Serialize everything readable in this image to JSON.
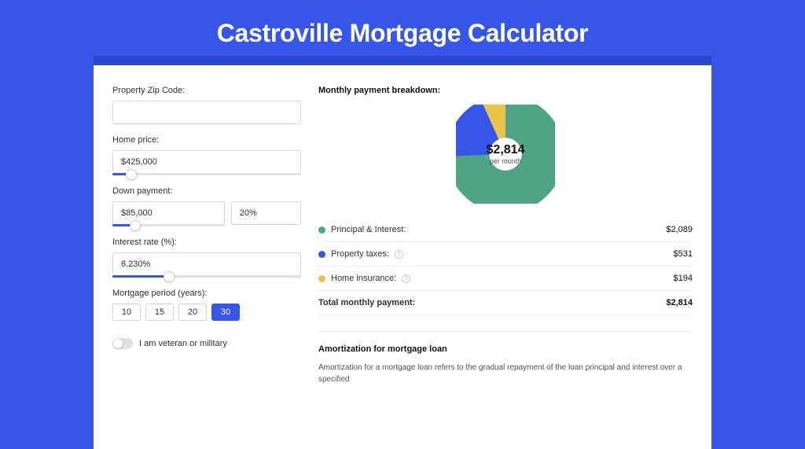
{
  "title": "Castroville Mortgage Calculator",
  "left": {
    "zip_label": "Property Zip Code:",
    "zip_value": "",
    "home_price_label": "Home price:",
    "home_price_value": "$425,000",
    "home_price_slider_pct": 10,
    "down_label": "Down payment:",
    "down_value": "$85,000",
    "down_pct": "20%",
    "down_slider_pct": 20,
    "rate_label": "Interest rate (%):",
    "rate_value": "6.230%",
    "rate_slider_pct": 30,
    "period_label": "Mortgage period (years):",
    "periods": [
      "10",
      "15",
      "20",
      "30"
    ],
    "period_active": "30",
    "veteran_label": "I am veteran or military",
    "veteran_on": false
  },
  "right": {
    "breakdown_title": "Monthly payment breakdown:",
    "donut_amount": "$2,814",
    "donut_per": "per month",
    "items": [
      {
        "color": "green",
        "label": "Principal & Interest:",
        "info": false,
        "value": "$2,089"
      },
      {
        "color": "blue",
        "label": "Property taxes:",
        "info": true,
        "value": "$531"
      },
      {
        "color": "gold",
        "label": "Home insurance:",
        "info": true,
        "value": "$194"
      }
    ],
    "total_label": "Total monthly payment:",
    "total_value": "$2,814",
    "amort_title": "Amortization for mortgage loan",
    "amort_text": "Amortization for a mortgage loan refers to the gradual repayment of the loan principal and interest over a specified"
  },
  "chart_data": {
    "type": "pie",
    "title": "Monthly payment breakdown",
    "series": [
      {
        "name": "Principal & Interest",
        "value": 2089,
        "color": "#4fa583"
      },
      {
        "name": "Property taxes",
        "value": 531,
        "color": "#3556e8"
      },
      {
        "name": "Home insurance",
        "value": 194,
        "color": "#e8c447"
      }
    ],
    "total": 2814,
    "center_label": "$2,814 per month"
  }
}
